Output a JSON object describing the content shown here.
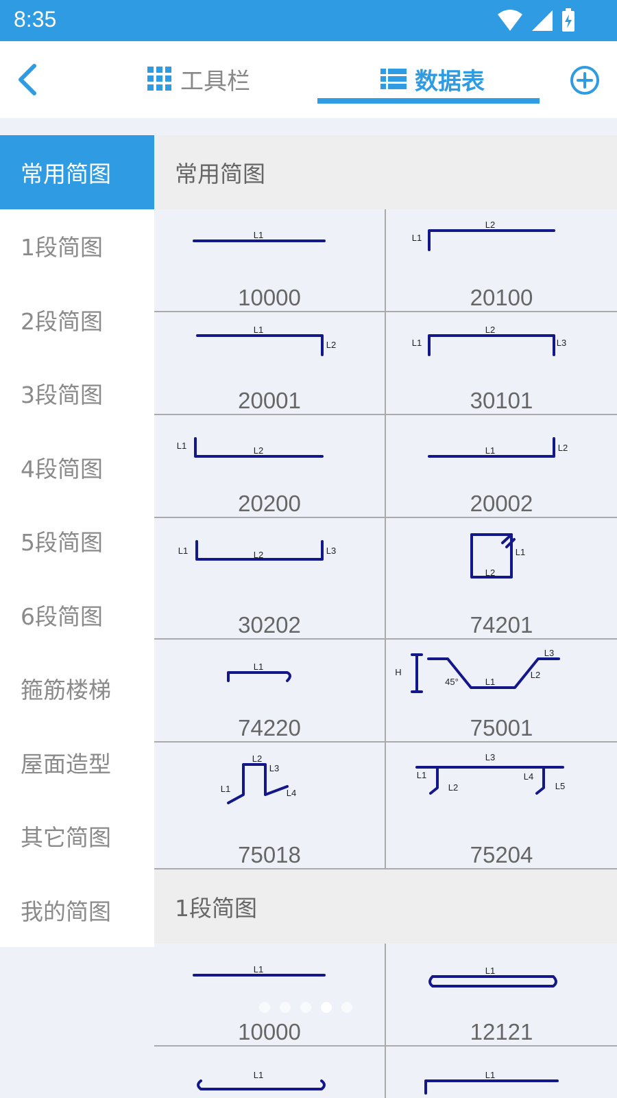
{
  "status": {
    "time": "8:35"
  },
  "header": {
    "tabs": [
      {
        "label": "工具栏"
      },
      {
        "label": "数据表"
      }
    ]
  },
  "sidebar": {
    "items": [
      {
        "label": "常用简图"
      },
      {
        "label": "1段简图"
      },
      {
        "label": "2段简图"
      },
      {
        "label": "3段简图"
      },
      {
        "label": "4段简图"
      },
      {
        "label": "5段简图"
      },
      {
        "label": "6段简图"
      },
      {
        "label": "箍筋楼梯"
      },
      {
        "label": "屋面造型"
      },
      {
        "label": "其它简图"
      },
      {
        "label": "我的简图"
      }
    ]
  },
  "sections": [
    {
      "title": "常用简图",
      "items": [
        {
          "code": "10000",
          "labels": [
            "L1"
          ]
        },
        {
          "code": "20100",
          "labels": [
            "L1",
            "L2"
          ]
        },
        {
          "code": "20001",
          "labels": [
            "L1",
            "L2"
          ]
        },
        {
          "code": "30101",
          "labels": [
            "L1",
            "L2",
            "L3"
          ]
        },
        {
          "code": "20200",
          "labels": [
            "L1",
            "L2"
          ]
        },
        {
          "code": "20002",
          "labels": [
            "L1",
            "L2"
          ]
        },
        {
          "code": "30202",
          "labels": [
            "L1",
            "L2",
            "L3"
          ]
        },
        {
          "code": "74201",
          "labels": [
            "L1",
            "L2"
          ]
        },
        {
          "code": "74220",
          "labels": [
            "L1"
          ]
        },
        {
          "code": "75001",
          "labels": [
            "H",
            "45°",
            "L1",
            "L2",
            "L3"
          ]
        },
        {
          "code": "75018",
          "labels": [
            "L1",
            "L2",
            "L3",
            "L4"
          ]
        },
        {
          "code": "75204",
          "labels": [
            "L1",
            "L2",
            "L3",
            "L4",
            "L5"
          ]
        }
      ]
    },
    {
      "title": "1段简图",
      "items": [
        {
          "code": "10000",
          "labels": [
            "L1"
          ]
        },
        {
          "code": "12121",
          "labels": [
            "L1"
          ]
        },
        {
          "code": "",
          "labels": [
            "L1"
          ]
        },
        {
          "code": "",
          "labels": [
            "L1"
          ]
        }
      ]
    }
  ],
  "pager": {
    "count": 5,
    "active_index": 3
  }
}
